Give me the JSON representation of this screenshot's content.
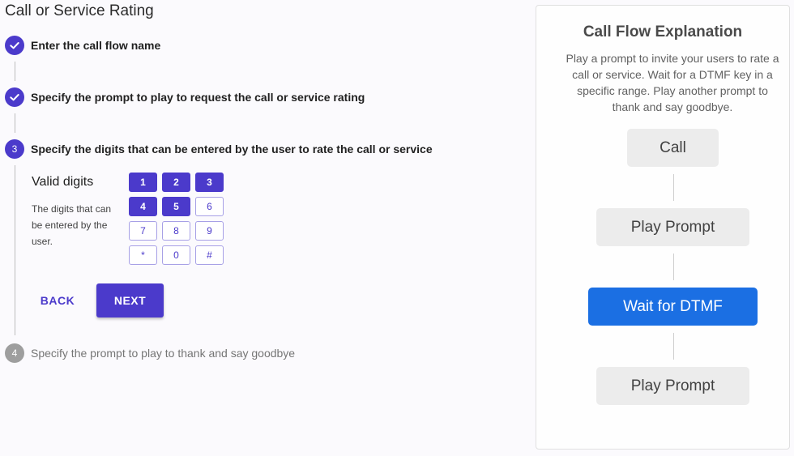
{
  "page": {
    "title": "Call or Service Rating"
  },
  "steps": [
    {
      "number": "1",
      "label": "Enter the call flow name",
      "state": "completed"
    },
    {
      "number": "2",
      "label": "Specify the prompt to play to request the call or service rating",
      "state": "completed"
    },
    {
      "number": "3",
      "label": "Specify the digits that can be entered by the user to rate the call or service",
      "state": "active"
    },
    {
      "number": "4",
      "label": "Specify the prompt to play to thank and say goodbye",
      "state": "pending"
    }
  ],
  "digits": {
    "title": "Valid digits",
    "description": "The digits that can be entered by the user.",
    "keys": [
      {
        "label": "1",
        "selected": true
      },
      {
        "label": "2",
        "selected": true
      },
      {
        "label": "3",
        "selected": true
      },
      {
        "label": "4",
        "selected": true
      },
      {
        "label": "5",
        "selected": true
      },
      {
        "label": "6",
        "selected": false
      },
      {
        "label": "7",
        "selected": false
      },
      {
        "label": "8",
        "selected": false
      },
      {
        "label": "9",
        "selected": false
      },
      {
        "label": "*",
        "selected": false
      },
      {
        "label": "0",
        "selected": false
      },
      {
        "label": "#",
        "selected": false
      }
    ]
  },
  "actions": {
    "back_label": "BACK",
    "next_label": "NEXT"
  },
  "explanation": {
    "title": "Call Flow Explanation",
    "description": "Play a prompt to invite your users to rate a call or service. Wait for a DTMF key in a specific range. Play another prompt to thank and say goodbye.",
    "nodes": [
      {
        "label": "Call",
        "active": false
      },
      {
        "label": "Play Prompt",
        "active": false
      },
      {
        "label": "Wait for DTMF",
        "active": true
      },
      {
        "label": "Play Prompt",
        "active": false
      }
    ]
  },
  "colors": {
    "accent": "#4b3acb",
    "flow_active": "#1b6fe3",
    "step_pending": "#9e9e9e"
  }
}
